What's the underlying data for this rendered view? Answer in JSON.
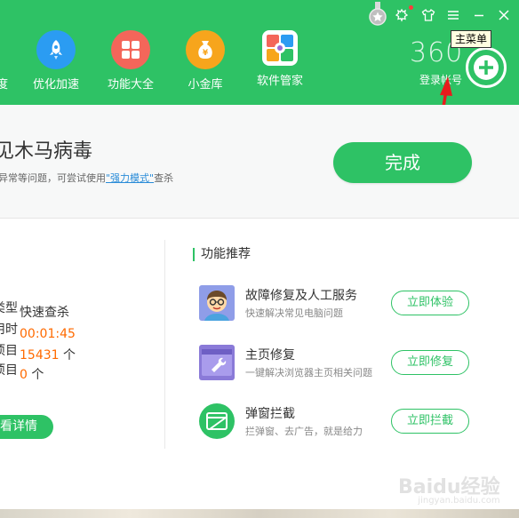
{
  "header": {
    "nav_cut_label": "度",
    "nav": [
      {
        "label": "优化加速",
        "icon": "rocket-icon",
        "color": "#2b9cf2"
      },
      {
        "label": "功能大全",
        "icon": "grid-icon",
        "color": "#f4665a"
      },
      {
        "label": "小金库",
        "icon": "money-bag-icon",
        "color": "#f7a51c"
      },
      {
        "label": "软件管家",
        "icon": "software-manager-icon",
        "color": "#2ec265"
      }
    ],
    "logo": "360",
    "login": "登录帐号",
    "tooltip": "主菜单",
    "window_buttons": [
      "medal-icon",
      "skin-icon",
      "shirt-icon",
      "menu-icon",
      "minimize-icon",
      "close-icon"
    ],
    "accent": "#2ec265"
  },
  "banner": {
    "title": "见木马病毒",
    "sub_prefix": "异常等问题，可尝试使用",
    "sub_link": "\"强力模式\"",
    "sub_suffix": "查杀",
    "done_button": "完成"
  },
  "stats": [
    {
      "key": "类型",
      "value": "快速查杀",
      "highlight": false
    },
    {
      "key": "用时",
      "value": "00:01:45",
      "highlight": true
    },
    {
      "key": "项目",
      "value": "15431",
      "unit": "个",
      "highlight": true
    },
    {
      "key": "项目",
      "value": "0",
      "unit": "个",
      "highlight": true
    }
  ],
  "details_button": "查看详情",
  "recommend": {
    "title": "功能推荐",
    "items": [
      {
        "name": "故障修复及人工服务",
        "desc": "快速解决常见电脑问题",
        "button": "立即体验",
        "icon": "support-agent-icon"
      },
      {
        "name": "主页修复",
        "desc": "一键解决浏览器主页相关问题",
        "button": "立即修复",
        "icon": "browser-repair-icon"
      },
      {
        "name": "弹窗拦截",
        "desc": "拦弹窗、去广告，就是给力",
        "button": "立即拦截",
        "icon": "popup-block-icon"
      }
    ]
  },
  "watermark": {
    "brand": "Baidu经验",
    "url": "jingyan.baidu.com"
  }
}
